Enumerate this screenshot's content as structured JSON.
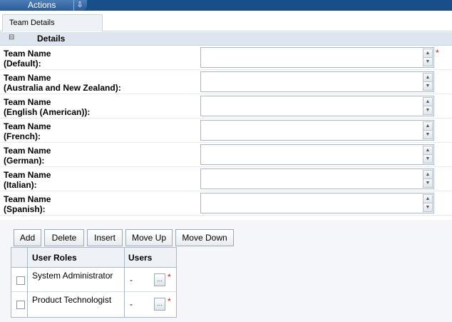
{
  "actions": {
    "label": "Actions",
    "arrow_icon": "download-arrow-icon"
  },
  "tabs": [
    {
      "label": "Team Details"
    }
  ],
  "section": {
    "title": "Details",
    "toggle": "⊟"
  },
  "fields": [
    {
      "label": "Team Name\n(Default):",
      "value": "",
      "required": true
    },
    {
      "label": "Team Name\n(Australia and New Zealand):",
      "value": "",
      "required": false
    },
    {
      "label": "Team Name\n(English (American)):",
      "value": "",
      "required": false
    },
    {
      "label": "Team Name\n(French):",
      "value": "",
      "required": false
    },
    {
      "label": "Team Name\n(German):",
      "value": "",
      "required": false
    },
    {
      "label": "Team Name\n(Italian):",
      "value": "",
      "required": false
    },
    {
      "label": "Team Name\n(Spanish):",
      "value": "",
      "required": false
    }
  ],
  "required_marker": "*",
  "toolbar": {
    "add": "Add",
    "delete": "Delete",
    "insert": "Insert",
    "move_up": "Move Up",
    "move_down": "Move Down"
  },
  "grid": {
    "columns": [
      "User Roles",
      "Users"
    ],
    "rows": [
      {
        "role": "System Administrator",
        "users": "-",
        "lookup": "...",
        "required": "*"
      },
      {
        "role": "Product Technologist",
        "users": "-",
        "lookup": "...",
        "required": "*"
      }
    ]
  },
  "colors": {
    "accent": "#1a4e8a",
    "required": "#d01010",
    "header_bg": "#dde5ee"
  }
}
